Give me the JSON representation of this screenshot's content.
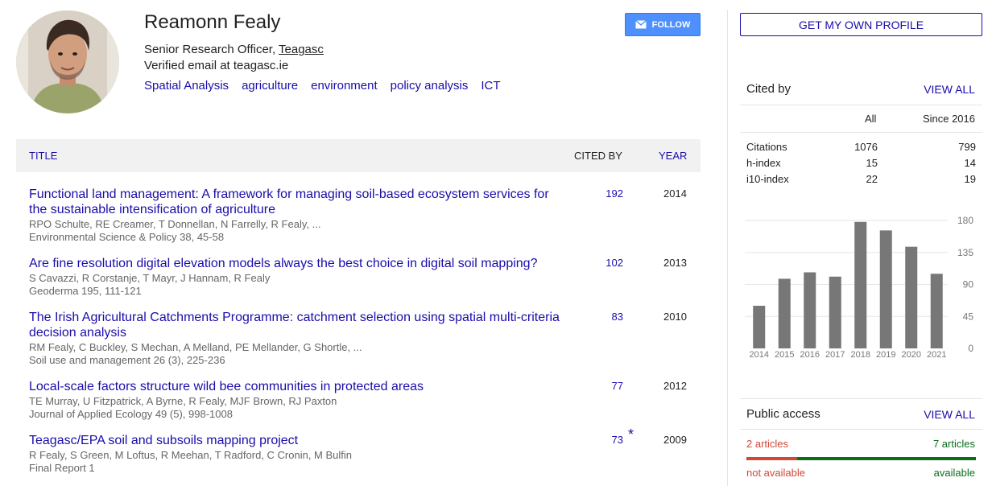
{
  "profile": {
    "name": "Reamonn Fealy",
    "position": "Senior Research Officer, ",
    "institution": "Teagasc",
    "email": "Verified email at teagasc.ie",
    "interests": [
      "Spatial Analysis",
      "agriculture",
      "environment",
      "policy analysis",
      "ICT"
    ],
    "follow_label": "FOLLOW"
  },
  "table": {
    "title_header": "TITLE",
    "cited_header": "CITED BY",
    "year_header": "YEAR",
    "articles": [
      {
        "title": "Functional land management: A framework for managing soil-based ecosystem services for the sustainable intensification of agriculture",
        "authors": "RPO Schulte, RE Creamer, T Donnellan, N Farrelly, R Fealy, ...",
        "venue": "Environmental Science & Policy 38, 45-58",
        "cited": "192",
        "star": "",
        "year": "2014"
      },
      {
        "title": "Are fine resolution digital elevation models always the best choice in digital soil mapping?",
        "authors": "S Cavazzi, R Corstanje, T Mayr, J Hannam, R Fealy",
        "venue": "Geoderma 195, 111-121",
        "cited": "102",
        "star": "",
        "year": "2013"
      },
      {
        "title": "The Irish Agricultural Catchments Programme: catchment selection using spatial multi-criteria decision analysis",
        "authors": "RM Fealy, C Buckley, S Mechan, A Melland, PE Mellander, G Shortle, ...",
        "venue": "Soil use and management 26 (3), 225-236",
        "cited": "83",
        "star": "",
        "year": "2010"
      },
      {
        "title": "Local-scale factors structure wild bee communities in protected areas",
        "authors": "TE Murray, U Fitzpatrick, A Byrne, R Fealy, MJF Brown, RJ Paxton",
        "venue": "Journal of Applied Ecology 49 (5), 998-1008",
        "cited": "77",
        "star": "",
        "year": "2012"
      },
      {
        "title": "Teagasc/EPA soil and subsoils mapping project",
        "authors": "R Fealy, S Green, M Loftus, R Meehan, T Radford, C Cronin, M Bulfin",
        "venue": "Final Report 1",
        "cited": "73",
        "star": "*",
        "year": "2009"
      }
    ]
  },
  "sidebar": {
    "own_profile_label": "GET MY OWN PROFILE",
    "cited_by": {
      "title": "Cited by",
      "view_all": "VIEW ALL",
      "col_all": "All",
      "col_since": "Since 2016",
      "rows": [
        {
          "label": "Citations",
          "all": "1076",
          "since": "799"
        },
        {
          "label": "h-index",
          "all": "15",
          "since": "14"
        },
        {
          "label": "i10-index",
          "all": "22",
          "since": "19"
        }
      ]
    },
    "public_access": {
      "title": "Public access",
      "view_all": "VIEW ALL",
      "not_available_count": "2 articles",
      "available_count": "7 articles",
      "not_available_label": "not available",
      "available_label": "available",
      "not_available_fraction": 0.2222
    }
  },
  "chart_data": {
    "type": "bar",
    "categories": [
      "2014",
      "2015",
      "2016",
      "2017",
      "2018",
      "2019",
      "2020",
      "2021"
    ],
    "values": [
      60,
      98,
      107,
      101,
      178,
      166,
      143,
      105
    ],
    "ylim": [
      0,
      180
    ],
    "yticks": [
      0,
      45,
      90,
      135,
      180
    ],
    "color": "#777777",
    "grid": true
  },
  "colors": {
    "link": "#1a0dab",
    "follow_bg": "#4d90fe",
    "not_available": "#d14836",
    "available": "#0b6e1e"
  }
}
